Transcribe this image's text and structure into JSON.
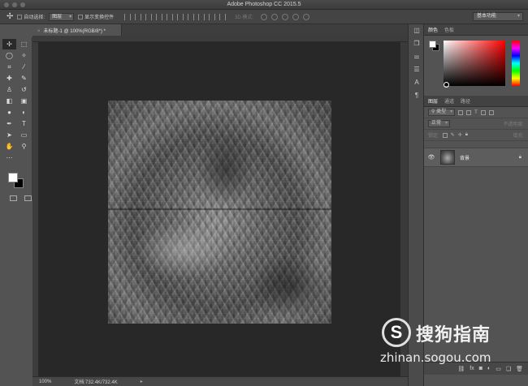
{
  "window": {
    "title": "Adobe Photoshop CC 2015.5"
  },
  "options_bar": {
    "auto_select_label": "自动选择:",
    "auto_select_value": "图层",
    "show_transform_label": "显示变换控件",
    "mode_3d_label": "3D 模式:",
    "workspace": "基本功能"
  },
  "document": {
    "tab_title": "未标题-1 @ 100%(RGB/8*) *",
    "close_glyph": "×"
  },
  "status_bar": {
    "zoom": "100%",
    "doc_size": "文档:732.4K/732.4K",
    "arrow": "▸"
  },
  "color_panel": {
    "tabs": [
      "颜色",
      "色板"
    ]
  },
  "layers_panel": {
    "tabs": [
      "图层",
      "通道",
      "路径"
    ],
    "kind_filter": "类型",
    "blend_mode": "正常",
    "opacity_label": "不透明度:",
    "lock_label": "锁定:",
    "fill_label": "填充:",
    "layers": [
      {
        "name": "背景",
        "locked": true
      }
    ]
  },
  "watermark": {
    "logo_letter": "S",
    "name": "搜狗指南",
    "url": "zhinan.sogou.com"
  }
}
